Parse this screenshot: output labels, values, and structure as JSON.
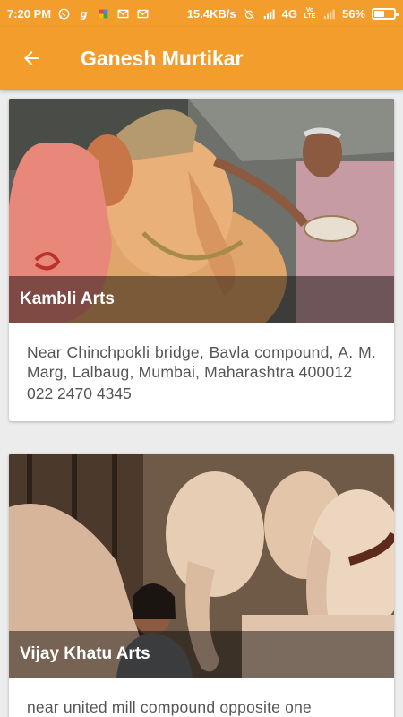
{
  "status_bar": {
    "time": "7:20 PM",
    "speed": "15.4KB/s",
    "network": "4G",
    "volte": "Vo LTE",
    "battery_text": "56%",
    "battery_level": 0.56
  },
  "app_bar": {
    "title": "Ganesh Murtikar",
    "back_icon": "arrow-back-icon"
  },
  "colors": {
    "primary": "#f29d2c",
    "background": "#ececec",
    "card": "#ffffff",
    "text": "#555555"
  },
  "listings": [
    {
      "name": "Kambli Arts",
      "address": "Near Chinchpokli bridge, Bavla compound, A. M. Marg, Lalbaug, Mumbai, Maharashtra 400012",
      "phone": "022 2470 4345"
    },
    {
      "name": "Vijay Khatu Arts",
      "address": "near united mill compound opposite one",
      "phone": ""
    }
  ]
}
